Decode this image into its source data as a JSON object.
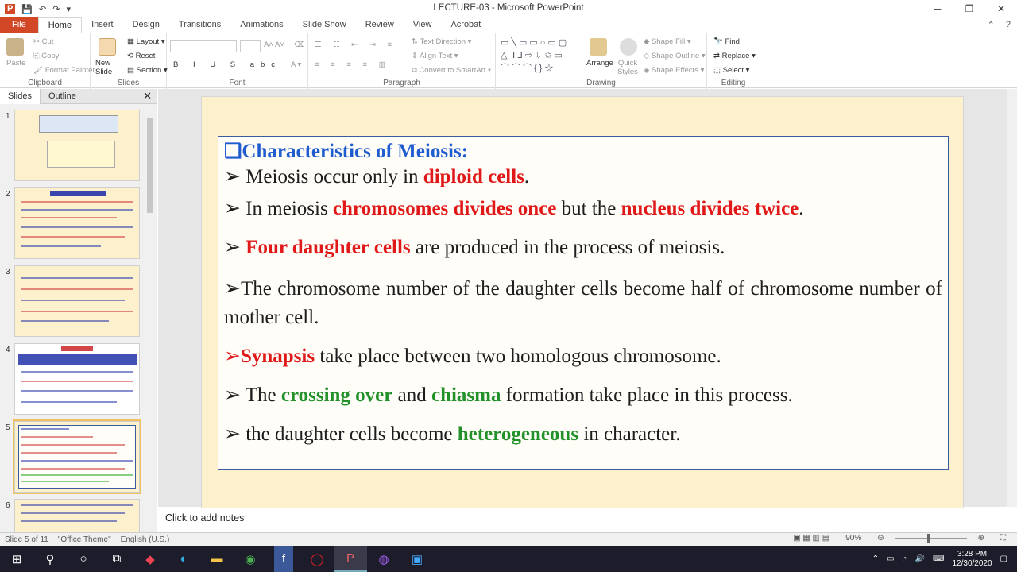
{
  "app": {
    "window_title": "LECTURE-03 - Microsoft PowerPoint",
    "quick_access": [
      "💾",
      "↶",
      "↷",
      "▾"
    ]
  },
  "tabs": [
    "File",
    "Home",
    "Insert",
    "Design",
    "Transitions",
    "Animations",
    "Slide Show",
    "Review",
    "View",
    "Acrobat"
  ],
  "ribbon": {
    "clipboard": {
      "label": "Clipboard",
      "paste": "Paste",
      "cut": "Cut",
      "copy": "Copy",
      "format_painter": "Format Painter"
    },
    "slides": {
      "label": "Slides",
      "new_slide": "New Slide",
      "layout": "Layout",
      "reset": "Reset",
      "section": "Section"
    },
    "font": {
      "label": "Font"
    },
    "paragraph": {
      "label": "Paragraph",
      "text_direction": "Text Direction",
      "align_text": "Align Text",
      "convert_smartart": "Convert to SmartArt"
    },
    "drawing": {
      "label": "Drawing",
      "arrange": "Arrange",
      "quick_styles": "Quick Styles",
      "shape_fill": "Shape Fill",
      "shape_outline": "Shape Outline",
      "shape_effects": "Shape Effects"
    },
    "editing": {
      "label": "Editing",
      "find": "Find",
      "replace": "Replace",
      "select": "Select"
    }
  },
  "left_pane": {
    "tabs": [
      "Slides",
      "Outline"
    ],
    "close": "✕",
    "slide_numbers": [
      "1",
      "2",
      "3",
      "4",
      "5",
      "6"
    ],
    "selected": 5
  },
  "slide": {
    "heading": "❑Characteristics of Meiosis:",
    "bullet": "➢",
    "line1": {
      "a": " Meiosis occur  only in ",
      "b": "diploid cells",
      "c": "."
    },
    "line2": {
      "a": " In meiosis ",
      "b": "chromosomes divides once",
      "c": " but the ",
      "d": "nucleus divides twice",
      "e": "."
    },
    "line3": {
      "a": " ",
      "b": "Four daughter cells",
      "c": " are produced  in the process of meiosis."
    },
    "line4": {
      "a": "The chromosome number of the daughter cells become half of chromosome number of mother cell."
    },
    "line5": {
      "b": "Synapsis",
      "c": " take place between  two homologous chromosome."
    },
    "line6": {
      "a": " The  ",
      "b": "crossing over",
      "c": " and ",
      "d": "chiasma",
      "e": " formation take place in this process."
    },
    "line7": {
      "a": " the daughter cells become ",
      "b": "heterogeneous",
      "c": " in  character."
    }
  },
  "notes": {
    "placeholder": "Click to add notes"
  },
  "status": {
    "slide": "Slide 5 of 11",
    "theme": "\"Office Theme\"",
    "language": "English (U.S.)",
    "zoom": "90%"
  },
  "taskbar": {
    "time": "3:28 PM",
    "date": "12/30/2020"
  }
}
